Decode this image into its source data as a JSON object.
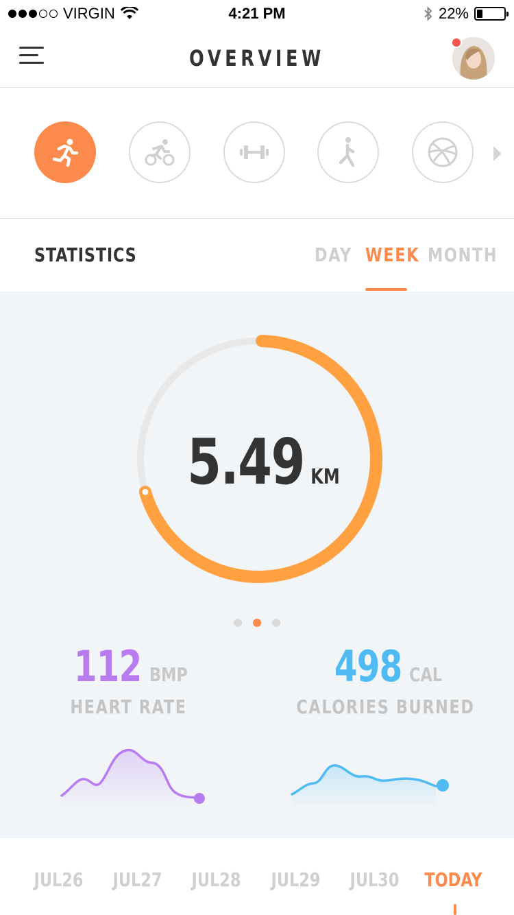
{
  "status_bar": {
    "carrier": "VIRGIN",
    "time": "4:21 PM",
    "battery": "22%",
    "battery_level": 0.22
  },
  "header": {
    "title": "OVERVIEW",
    "menu_icon": "hamburger-icon",
    "has_notification": true
  },
  "activities": [
    {
      "icon": "running-icon",
      "active": true
    },
    {
      "icon": "cycling-icon",
      "active": false
    },
    {
      "icon": "dumbbell-icon",
      "active": false
    },
    {
      "icon": "walking-icon",
      "active": false
    },
    {
      "icon": "basketball-icon",
      "active": false
    }
  ],
  "statistics": {
    "label": "STATISTICS",
    "tabs": [
      "DAY",
      "WEEK",
      "MONTH"
    ],
    "active_tab": "WEEK"
  },
  "distance": {
    "value": "5.49",
    "unit": "KM",
    "progress": 0.7
  },
  "pager": {
    "count": 3,
    "active": 2
  },
  "heart_rate": {
    "value": "112",
    "unit": "BMP",
    "label": "HEART RATE",
    "color": "#b97cf0"
  },
  "calories": {
    "value": "498",
    "unit": "CAL",
    "label": "CALORIES BURNED",
    "color": "#4fbbf2"
  },
  "dates": [
    "JUL26",
    "JUL27",
    "JUL28",
    "JUL29",
    "JUL30",
    "TODAY"
  ],
  "active_date": "TODAY",
  "colors": {
    "accent": "#fc8a4d",
    "ring": "#ffa041",
    "ring_track": "#e8e8e8",
    "background": "#f1f5f8"
  }
}
